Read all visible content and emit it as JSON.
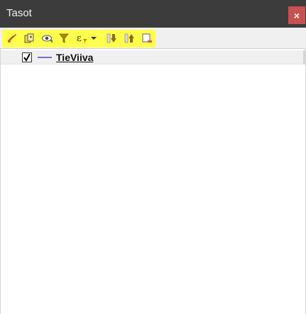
{
  "window": {
    "title": "Tasot",
    "close_label": "×"
  },
  "toolbar": {
    "highlight_color": "#ffff4c",
    "buttons": [
      {
        "name": "style-brush-icon"
      },
      {
        "name": "add-group-icon"
      },
      {
        "name": "visibility-eye-icon"
      },
      {
        "name": "filter-icon"
      },
      {
        "name": "filter-expression-icon"
      },
      {
        "name": "expand-all-icon"
      },
      {
        "name": "collapse-all-icon"
      },
      {
        "name": "remove-layer-icon"
      }
    ]
  },
  "layers": [
    {
      "name": "TieViiva",
      "checked": true,
      "symbol_color": "#7b6cc9"
    }
  ]
}
